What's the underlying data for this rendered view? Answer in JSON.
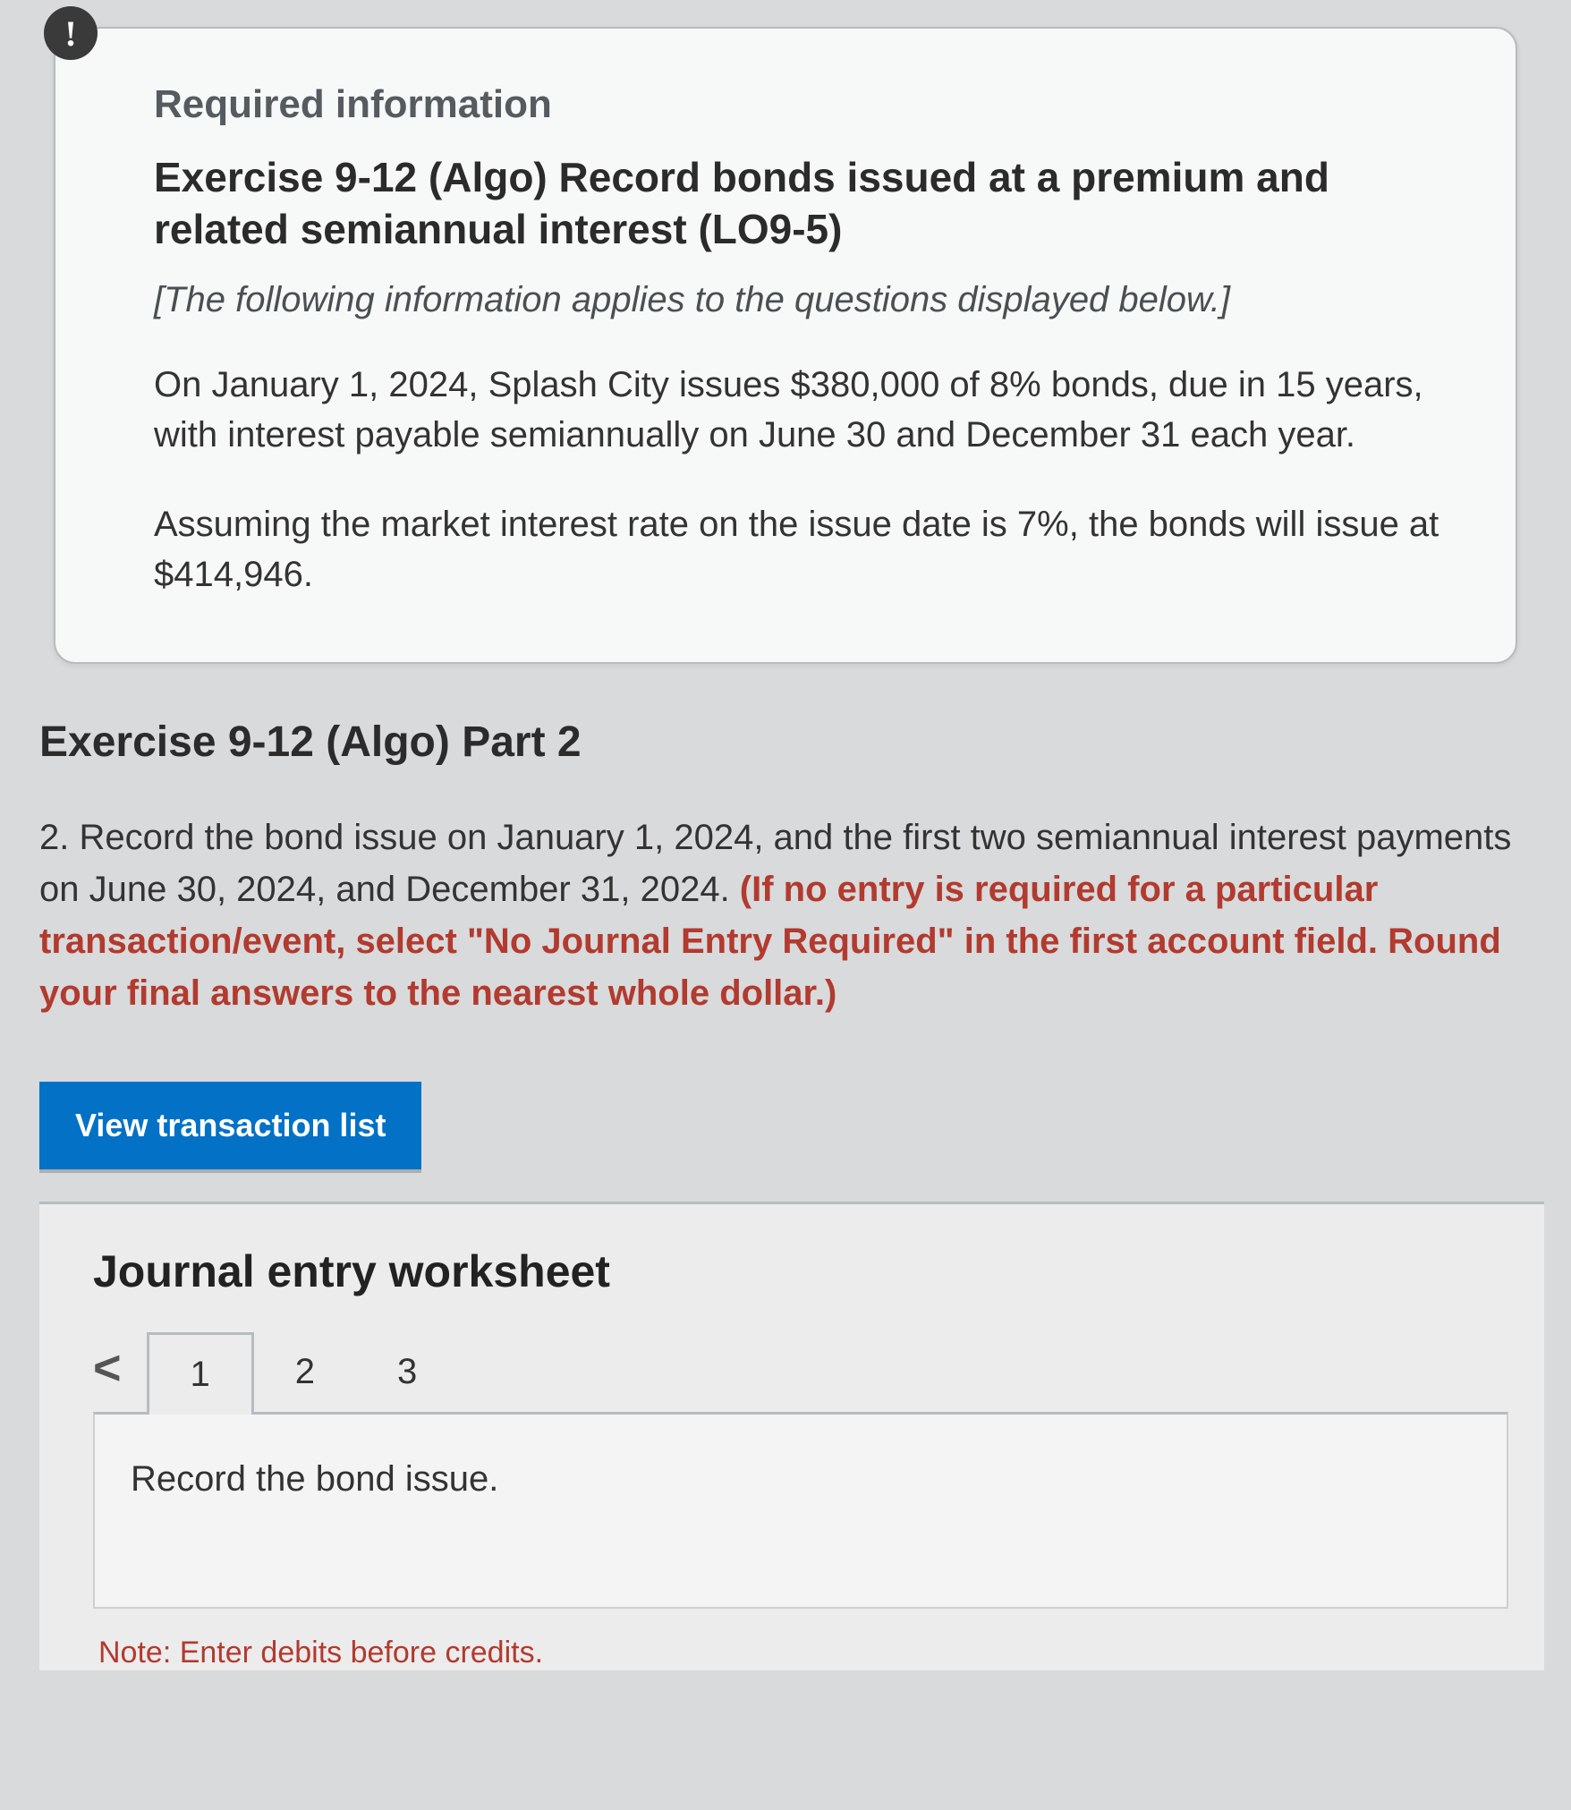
{
  "alert_symbol": "!",
  "card": {
    "required_label": "Required information",
    "exercise_heading": "Exercise 9-12 (Algo) Record bonds issued at a premium and related semiannual interest (LO9-5)",
    "applies_note": "[The following information applies to the questions displayed below.]",
    "para1": "On January 1, 2024, Splash City issues $380,000 of 8% bonds, due in 15 years, with interest payable semiannually on June 30 and December 31 each year.",
    "para2": "Assuming the market interest rate on the issue date is 7%, the bonds will issue at $414,946."
  },
  "part_heading": "Exercise 9-12 (Algo) Part 2",
  "question": {
    "lead": "2. Record the bond issue on January 1, 2024, and the first two semiannual interest payments on June 30, 2024, and December 31, 2024. ",
    "bold": "(If no entry is required for a particular transaction/event, select \"No Journal Entry Required\" in the first account field. Round your final answers to the nearest whole dollar.)"
  },
  "view_btn": "View transaction list",
  "worksheet": {
    "title": "Journal entry worksheet",
    "chevron": "<",
    "tabs": [
      "1",
      "2",
      "3"
    ],
    "instruction": "Record the bond issue.",
    "note": "Note: Enter debits before credits."
  }
}
